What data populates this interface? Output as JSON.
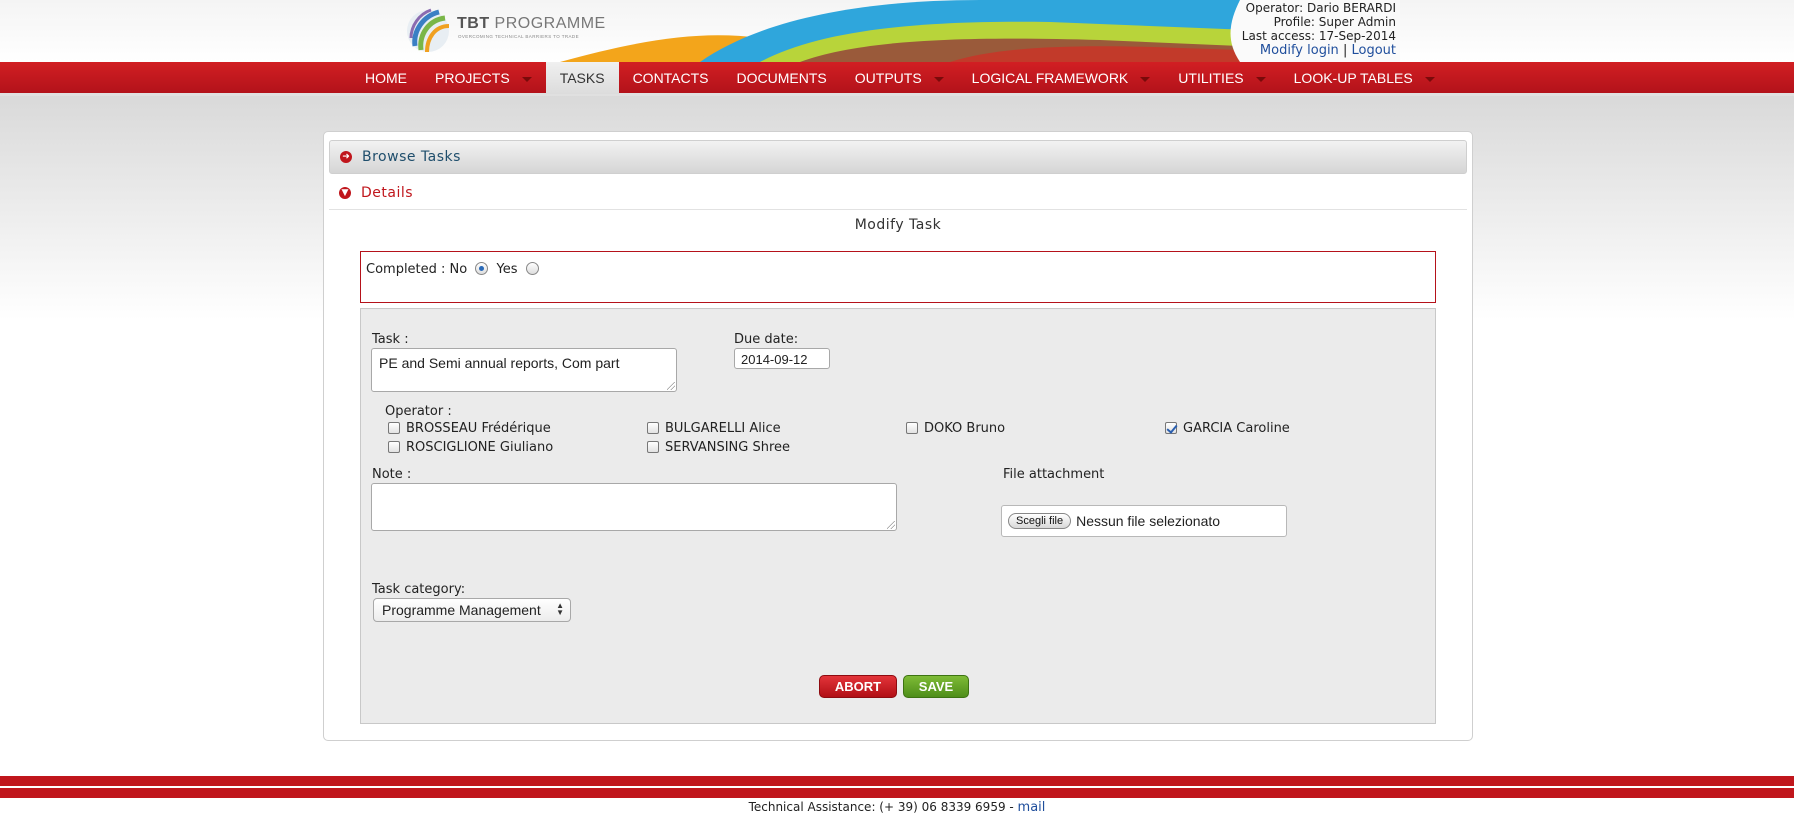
{
  "header": {
    "logo_title_bold": "TBT",
    "logo_title_rest": " PROGRAMME",
    "logo_tagline": "OVERCOMING TECHNICAL BARRIERS TO TRADE",
    "operator": "Operator: Dario BERARDI",
    "profile": "Profile: Super Admin",
    "last_access": "Last access: 17-Sep-2014",
    "modify_login": "Modify login",
    "separator": "|",
    "logout": "Logout"
  },
  "nav": {
    "items": [
      {
        "label": "HOME",
        "dropdown": false
      },
      {
        "label": "PROJECTS",
        "dropdown": true
      },
      {
        "label": "TASKS",
        "dropdown": false,
        "active": true
      },
      {
        "label": "CONTACTS",
        "dropdown": false
      },
      {
        "label": "DOCUMENTS",
        "dropdown": false
      },
      {
        "label": "OUTPUTS",
        "dropdown": true
      },
      {
        "label": "LOGICAL FRAMEWORK",
        "dropdown": true
      },
      {
        "label": "UTILITIES",
        "dropdown": true
      },
      {
        "label": "LOOK-UP TABLES",
        "dropdown": true
      }
    ]
  },
  "accordion": {
    "browse_label": "Browse Tasks",
    "details_label": "Details"
  },
  "form": {
    "title": "Modify Task",
    "completed_label": "Completed : No",
    "completed_yes": "Yes",
    "completed_value": "No",
    "task_label": "Task :",
    "task_value": "PE and Semi annual reports, Com part",
    "due_label": "Due date:",
    "due_value": "2014-09-12",
    "operator_label": "Operator :",
    "operators": [
      {
        "name": "BROSSEAU Frédérique",
        "checked": false
      },
      {
        "name": "BULGARELLI Alice",
        "checked": false
      },
      {
        "name": "DOKO Bruno",
        "checked": false
      },
      {
        "name": "GARCIA Caroline",
        "checked": true
      },
      {
        "name": "ROSCIGLIONE Giuliano",
        "checked": false
      },
      {
        "name": "SERVANSING Shree",
        "checked": false
      }
    ],
    "note_label": "Note :",
    "note_value": "",
    "file_label": "File attachment",
    "file_button": "Scegli file",
    "file_status": "Nessun file selezionato",
    "category_label": "Task category:",
    "category_value": "Programme Management",
    "abort_label": "ABORT",
    "save_label": "SAVE"
  },
  "footer": {
    "assistance": "Technical Assistance: (+ 39) 06 8339 6959 - ",
    "mail": "mail"
  },
  "colors": {
    "brand_red": "#c0161c",
    "link_blue": "#1f4e9c",
    "save_green": "#5a9a22"
  }
}
